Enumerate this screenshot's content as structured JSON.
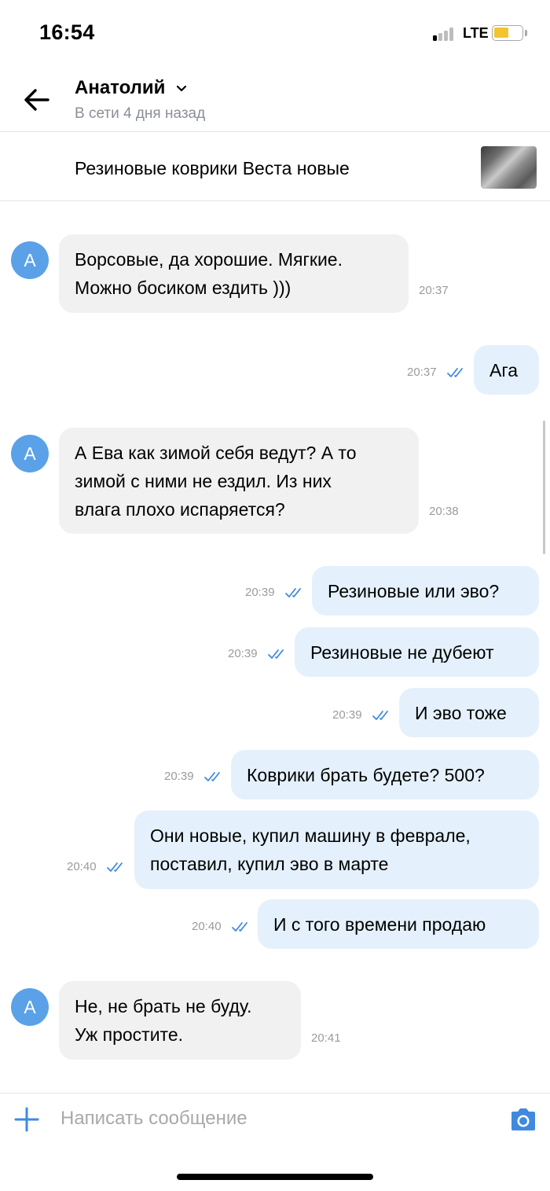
{
  "status_bar": {
    "time": "16:54",
    "network": "LTE",
    "battery_color": "#f3c430"
  },
  "header": {
    "back_icon": "arrow-left-icon",
    "contact_name": "Анатолий",
    "contact_status": "В сети 4 дня назад"
  },
  "item": {
    "title": "Резиновые коврики Веста новые"
  },
  "messages": [
    {
      "dir": "in",
      "avatar": "А",
      "lines": [
        "Ворсовые, да хорошие. Мягкие.",
        "Можно босиком ездить )))"
      ],
      "time": "20:37"
    },
    {
      "dir": "out",
      "lines": [
        "Ага"
      ],
      "time": "20:37",
      "status": "read"
    },
    {
      "dir": "in",
      "avatar": "А",
      "lines": [
        "А Ева как зимой себя ведут? А то",
        "зимой с ними не ездил. Из них",
        "влага плохо испаряется?"
      ],
      "time": "20:38"
    },
    {
      "dir": "out",
      "lines": [
        "Резиновые или эво?"
      ],
      "time": "20:39",
      "status": "read"
    },
    {
      "dir": "out",
      "lines": [
        "Резиновые не дубеют"
      ],
      "time": "20:39",
      "status": "read"
    },
    {
      "dir": "out",
      "lines": [
        "И эво тоже"
      ],
      "time": "20:39",
      "status": "read"
    },
    {
      "dir": "out",
      "lines": [
        "Коврики брать будете? 500?"
      ],
      "time": "20:39",
      "status": "read"
    },
    {
      "dir": "out",
      "lines": [
        "Они новые, купил машину в феврале,",
        "поставил, купил эво в марте"
      ],
      "time": "20:40",
      "status": "read"
    },
    {
      "dir": "out",
      "lines": [
        "И с того времени продаю"
      ],
      "time": "20:40",
      "status": "read"
    },
    {
      "dir": "in",
      "avatar": "А",
      "lines": [
        "Не, не брать не буду.",
        "Уж простите."
      ],
      "time": "20:41"
    }
  ],
  "composer": {
    "placeholder": "Написать сообщение",
    "value": ""
  },
  "colors": {
    "accent": "#3f8ae0",
    "incoming_bubble": "#f1f1f1",
    "outgoing_bubble": "#e4f1fc",
    "avatar": "#5aa1e8"
  }
}
